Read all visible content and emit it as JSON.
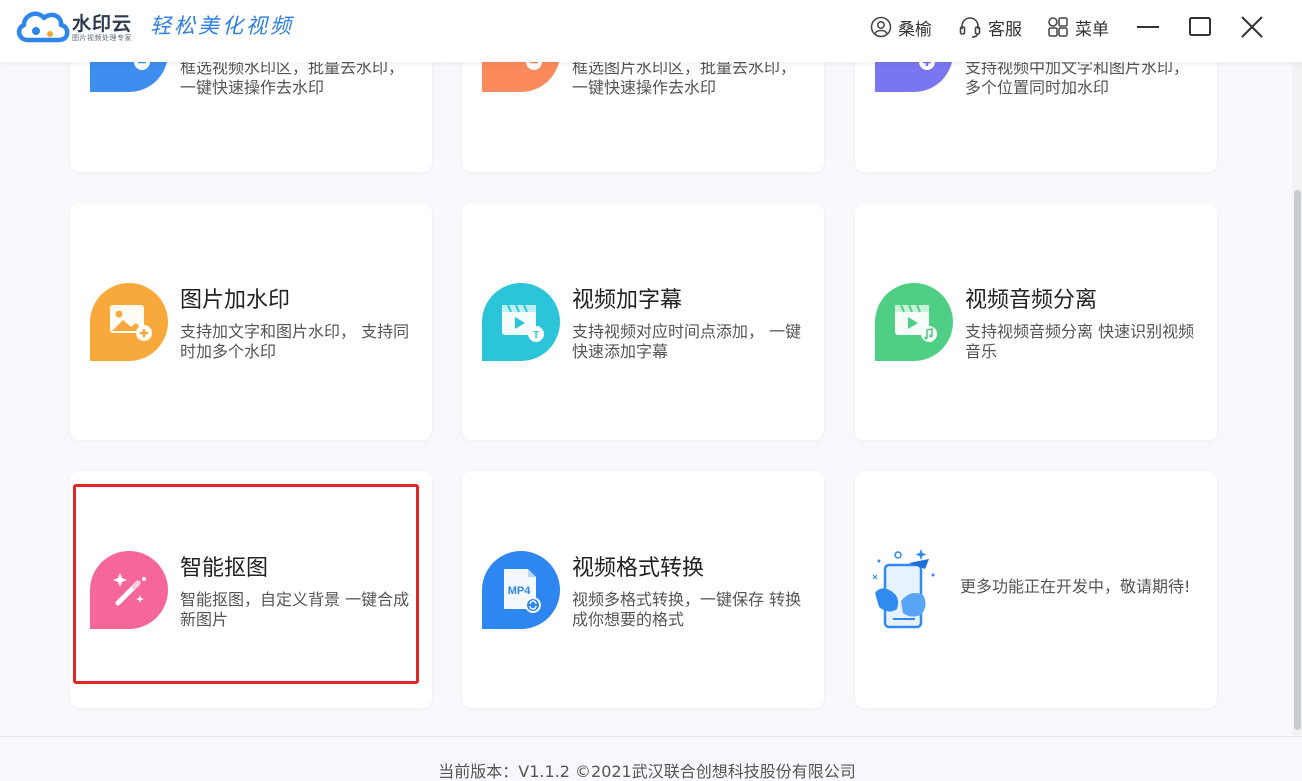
{
  "header": {
    "brand_name": "水印云",
    "brand_subtitle": "图片视频处理专家",
    "slogan": "轻松美化视频",
    "user_label": "桑榆",
    "service_label": "客服",
    "menu_label": "菜单",
    "icons": [
      "cloud-logo",
      "user-icon",
      "headset-icon",
      "grid-menu-icon",
      "minimize-icon",
      "maximize-icon",
      "close-icon"
    ]
  },
  "cards": [
    {
      "title": "",
      "desc": "框选视频水印区，批量去水印，一键快速操作去水印",
      "icon": "video-remove-icon",
      "color": "#3d8ef0"
    },
    {
      "title": "",
      "desc": "框选图片水印区，批量去水印，一键快速操作去水印",
      "icon": "image-remove-icon",
      "color": "#fb8a5c"
    },
    {
      "title": "",
      "desc": "支持视频中加文字和图片水印，多个位置同时加水印",
      "icon": "video-add-icon",
      "color": "#7a76f0"
    },
    {
      "title": "图片加水印",
      "desc": "支持加文字和图片水印， 支持同时加多个水印",
      "icon": "image-add-icon",
      "color": "#f7a93b"
    },
    {
      "title": "视频加字幕",
      "desc": "支持视频对应时间点添加， 一键快速添加字幕",
      "icon": "video-subtitle-icon",
      "color": "#2bc4d9"
    },
    {
      "title": "视频音频分离",
      "desc": "支持视频音频分离 快速识别视频音乐",
      "icon": "audio-separate-icon",
      "color": "#4fcf86"
    },
    {
      "title": "智能抠图",
      "desc": "智能抠图，自定义背景 一键合成新图片",
      "icon": "magic-wand-icon",
      "color": "#f5679a"
    },
    {
      "title": "视频格式转换",
      "desc": "视频多格式转换，一键保存 转换成你想要的格式",
      "icon": "mp4-convert-icon",
      "color": "#2e86f0",
      "badge": "MP4"
    },
    {
      "title": "",
      "desc": "更多功能正在开发中，敬请期待!",
      "icon": "developing-illustration",
      "color": "#2f8bf0"
    }
  ],
  "footer": {
    "text": "当前版本：V1.1.2 ©2021武汉联合创想科技股份有限公司"
  }
}
